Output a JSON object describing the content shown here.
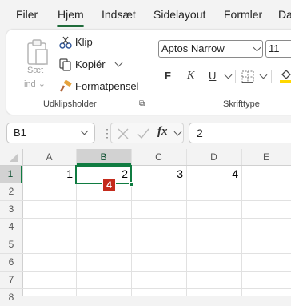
{
  "menu": {
    "tabs": [
      {
        "label": "Filer"
      },
      {
        "label": "Hjem"
      },
      {
        "label": "Indsæt"
      },
      {
        "label": "Sidelayout"
      },
      {
        "label": "Formler"
      },
      {
        "label": "Da"
      }
    ],
    "active_tab": "Hjem"
  },
  "ribbon": {
    "clipboard": {
      "paste_label_line1": "Sæt",
      "paste_label_line2": "ind",
      "cut_label": "Klip",
      "copy_label": "Kopiér",
      "format_painter_label": "Formatpensel",
      "group_label": "Udklipsholder"
    },
    "font": {
      "font_name": "Aptos Narrow",
      "font_size": "11",
      "bold_label": "F",
      "italic_label": "K",
      "underline_label": "U",
      "group_label": "Skrifttype"
    }
  },
  "formula_bar": {
    "name_box": "B1",
    "fx_label": "fx",
    "value": "2"
  },
  "sheet": {
    "columns": [
      "A",
      "B",
      "C",
      "D",
      "E"
    ],
    "rows": [
      "1",
      "2",
      "3",
      "4",
      "5",
      "6",
      "7",
      "8"
    ],
    "row1": {
      "A": "1",
      "B": "2",
      "C": "3",
      "D": "4"
    },
    "badge": "4"
  },
  "colors": {
    "accent": "#1f6b3a",
    "selection": "#107c41",
    "badge": "#c42b1c"
  }
}
